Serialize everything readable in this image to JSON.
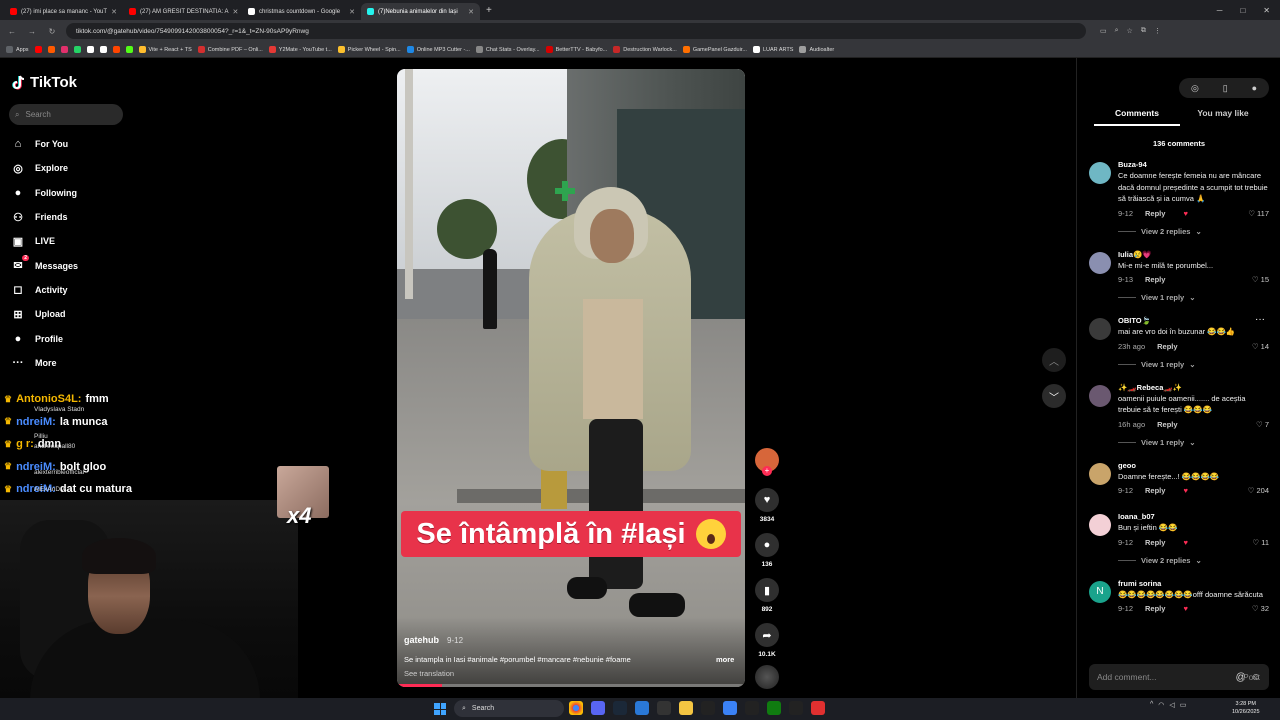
{
  "browser": {
    "tabs": [
      {
        "title": "(27) imi place sa mananc - YouT",
        "color": "#ff0000"
      },
      {
        "title": "(27) AM GRESIT DESTINATIA: A",
        "color": "#ff0000"
      },
      {
        "title": "christmas countdown - Google",
        "color": "#ffffff"
      },
      {
        "title": "(7)Nebunia animalelor din Iași",
        "color": "#25f4ee",
        "active": true
      }
    ],
    "new_tab": "+",
    "url": "tiktok.com/@gatehub/video/7549099142003800054?_r=1&_t=ZN-90sAP9yRnwg",
    "bookmarks": [
      {
        "label": "Apps",
        "color": "#5f6368"
      },
      {
        "label": "",
        "color": "#ff0000"
      },
      {
        "label": "",
        "color": "#ff5a00"
      },
      {
        "label": "",
        "color": "#e1306c"
      },
      {
        "label": "",
        "color": "#25d366"
      },
      {
        "label": "",
        "color": "#ffffff"
      },
      {
        "label": "",
        "color": "#ffffff"
      },
      {
        "label": "",
        "color": "#ff4500"
      },
      {
        "label": "",
        "color": "#53fc18"
      },
      {
        "label": "Vite + React + TS",
        "color": "#ffbd2e"
      },
      {
        "label": "Combine PDF – Onli...",
        "color": "#d32f2f"
      },
      {
        "label": "Y2Mate - YouTube t...",
        "color": "#e53935"
      },
      {
        "label": "Picker Wheel - Spin...",
        "color": "#fbc02d"
      },
      {
        "label": "Online MP3 Cutter -...",
        "color": "#1e88e5"
      },
      {
        "label": "Chat Stats - Overlay...",
        "color": "#888888"
      },
      {
        "label": "BetterTTV - Babyfo...",
        "color": "#d50000"
      },
      {
        "label": "Destruction Warlock...",
        "color": "#c62828"
      },
      {
        "label": "GamePanel Gazduir...",
        "color": "#ff6f00"
      },
      {
        "label": "LUAR ARTS",
        "color": "#ffffff"
      },
      {
        "label": "Audioalter",
        "color": "#9e9e9e"
      }
    ]
  },
  "tiktok": {
    "logo": "TikTok",
    "search_placeholder": "Search",
    "nav": [
      {
        "label": "For You",
        "icon": "home-icon"
      },
      {
        "label": "Explore",
        "icon": "compass-icon"
      },
      {
        "label": "Following",
        "icon": "following-avatar-icon"
      },
      {
        "label": "Friends",
        "icon": "friends-icon"
      },
      {
        "label": "LIVE",
        "icon": "live-icon"
      },
      {
        "label": "Messages",
        "icon": "messages-icon",
        "badge": "2"
      },
      {
        "label": "Activity",
        "icon": "activity-icon"
      },
      {
        "label": "Upload",
        "icon": "upload-icon"
      },
      {
        "label": "Profile",
        "icon": "profile-avatar-icon"
      },
      {
        "label": "More",
        "icon": "more-icon"
      }
    ]
  },
  "stream_chat": [
    {
      "user": "AntonioS4L:",
      "message": "fmm",
      "color": "#f5b800"
    },
    {
      "user": "ndreiM:",
      "message": "la munca",
      "color": "#4a8cff"
    },
    {
      "user": "g r:",
      "message": "dmn",
      "color": "#f5b800"
    },
    {
      "user": "ndreiM:",
      "message": "bolt gloo",
      "color": "#4a8cff"
    },
    {
      "user": "ndreiM:",
      "message": "dat cu matura",
      "color": "#4a8cff"
    }
  ],
  "stream_overlay_users": [
    "Vladyslava Stadn",
    "Pilliu",
    "andreeapall80",
    "alexterribleofficial",
    "AlExAnDrA"
  ],
  "sticker_label": "x4",
  "video": {
    "caption_overlay": "Se întâmplă în #Iași",
    "author": "gatehub",
    "date": "9-12",
    "description": "Se intampla in Iasi #animale #porumbel #mancare #nebunie #foame",
    "more": "more",
    "see_translation": "See translation",
    "progress": 0.13
  },
  "actions": {
    "likes": "3834",
    "comments": "136",
    "saves": "892",
    "shares": "10.1K"
  },
  "comments_panel": {
    "tabs": [
      "Comments",
      "You may like"
    ],
    "count_label": "136 comments",
    "reply_label": "Reply",
    "items": [
      {
        "user": "Buza-94",
        "text": "Ce doamne ferește femeia nu are mâncare dacă domnul președinte a scumpit tot trebuie să trăiască și ia cumva 🙏",
        "date": "9-12",
        "likes": "117",
        "view": "View 2 replies",
        "avatar": "#6fb7c4",
        "creator_liked": true
      },
      {
        "user": "Iulia😢💗",
        "text": "Mi-e mi-e milă te porumbel...",
        "date": "9-13",
        "likes": "15",
        "view": "View 1 reply",
        "avatar": "#8a8fb0",
        "creator_liked": false
      },
      {
        "user": "OBITO🍃",
        "text": "mai are vro doi în buzunar 😂😂👍",
        "date": "23h ago",
        "likes": "14",
        "view": "View 1 reply",
        "avatar": "#3a3a3a",
        "creator_liked": false,
        "dots": "···"
      },
      {
        "user": "✨🏎️Rebeca🏎️✨",
        "text": "oamenii puiule oamenii....... de aceștia trebuie să te ferești 😂😂😂",
        "date": "16h ago",
        "likes": "7",
        "view": "View 1 reply",
        "avatar": "#6a5870",
        "creator_liked": false
      },
      {
        "user": "geoo",
        "text": "Doamne ferește...! 😂😂😂😂",
        "date": "9-12",
        "likes": "204",
        "view": "",
        "avatar": "#c9a46a",
        "creator_liked": true
      },
      {
        "user": "Ioana_b07",
        "text": "Bun și ieftin 😂😂",
        "date": "9-12",
        "likes": "11",
        "view": "View 2 replies",
        "avatar": "#f3d0d6",
        "creator_liked": true
      },
      {
        "user": "frumi sorina",
        "text": "😂😂😂😂😂😂😂😂offf doamne sărăcuta",
        "date": "9-12",
        "likes": "32",
        "view": "",
        "avatar": "#1aa38c",
        "avatar_letter": "N",
        "creator_liked": true
      }
    ],
    "add_placeholder": "Add comment...",
    "post": "Post"
  },
  "taskbar": {
    "search": "Search",
    "time": "3:28 PM",
    "date": "10/26/2025"
  }
}
